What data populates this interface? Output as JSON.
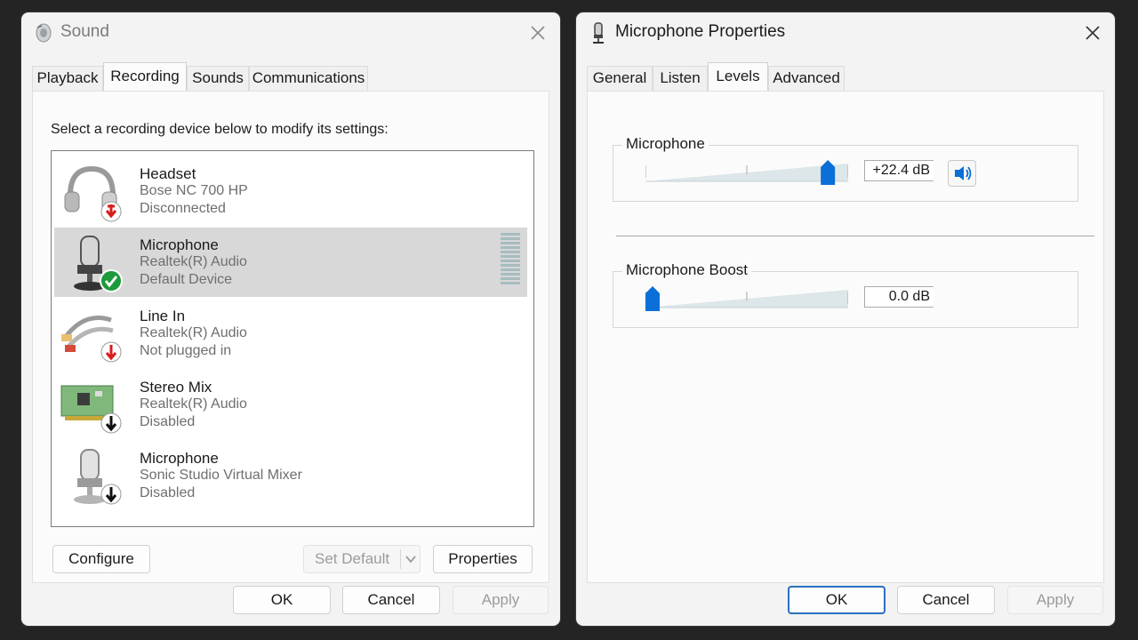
{
  "sound_window": {
    "title": "Sound",
    "tabs": [
      "Playback",
      "Recording",
      "Sounds",
      "Communications"
    ],
    "active_tab": "Recording",
    "instruction": "Select a recording device below to modify its settings:",
    "devices": [
      {
        "name": "Headset",
        "sub": "Bose NC 700 HP",
        "status": "Disconnected",
        "icon": "headset-icon",
        "badge": "red-down-arrow"
      },
      {
        "name": "Microphone",
        "sub": "Realtek(R) Audio",
        "status": "Default Device",
        "icon": "microphone-icon",
        "badge": "green-check",
        "selected": true
      },
      {
        "name": "Line In",
        "sub": "Realtek(R) Audio",
        "status": "Not plugged in",
        "icon": "audio-cable-icon",
        "badge": "red-down-arrow"
      },
      {
        "name": "Stereo Mix",
        "sub": "Realtek(R) Audio",
        "status": "Disabled",
        "icon": "sound-card-icon",
        "badge": "black-down-arrow"
      },
      {
        "name": "Microphone",
        "sub": "Sonic Studio Virtual Mixer",
        "status": "Disabled",
        "icon": "microphone-icon",
        "badge": "black-down-arrow"
      }
    ],
    "buttons": {
      "configure": "Configure",
      "set_default": "Set Default",
      "properties": "Properties",
      "ok": "OK",
      "cancel": "Cancel",
      "apply": "Apply"
    }
  },
  "mic_window": {
    "title": "Microphone Properties",
    "tabs": [
      "General",
      "Listen",
      "Levels",
      "Advanced"
    ],
    "active_tab": "Levels",
    "microphone": {
      "label": "Microphone",
      "value_text": "+22.4 dB",
      "level_fraction": 0.93
    },
    "boost": {
      "label": "Microphone Boost",
      "value_text": "0.0 dB",
      "level_fraction": 0.0
    },
    "buttons": {
      "ok": "OK",
      "cancel": "Cancel",
      "apply": "Apply"
    }
  },
  "colors": {
    "accent": "#0a6fd6",
    "selected_row": "#d8d8d8",
    "green_check": "#1d9a3c",
    "red_badge": "#d81c1c"
  }
}
